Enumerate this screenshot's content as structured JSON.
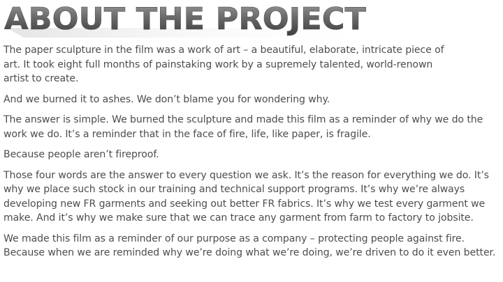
{
  "heading": {
    "title": "ABOUT THE PROJECT"
  },
  "paragraphs": [
    "The paper sculpture in the film was a work of art – a beautiful, elaborate, intricate piece of art. It took eight full months of painstaking work by a supremely talented, world-renown artist to create.",
    "And we burned it to ashes. We don’t blame you for wondering why.",
    "The answer is simple. We burned the sculpture and made this film as a reminder of why we do the work we do. It’s a reminder that in the face of fire, life, like paper, is fragile.",
    "Because people aren’t fireproof.",
    "Those four words are the answer to every question we ask. It’s the reason for everything we do. It’s why we place such stock in our training and technical support programs. It’s why we’re always developing new FR garments and seeking out better FR fabrics. It’s why we test every garment we make. And it’s why we make sure that we can trace any garment from farm to factory to jobsite.",
    "We made this film as a reminder of our purpose as a company – protecting people against fire. Because when we are reminded why we’re doing what we’re doing, we’re driven to do it even better."
  ],
  "colors": {
    "body_text": "#4d4d4d",
    "heading_light": "#8a8a8a",
    "heading_dark": "#3a3a3a"
  }
}
